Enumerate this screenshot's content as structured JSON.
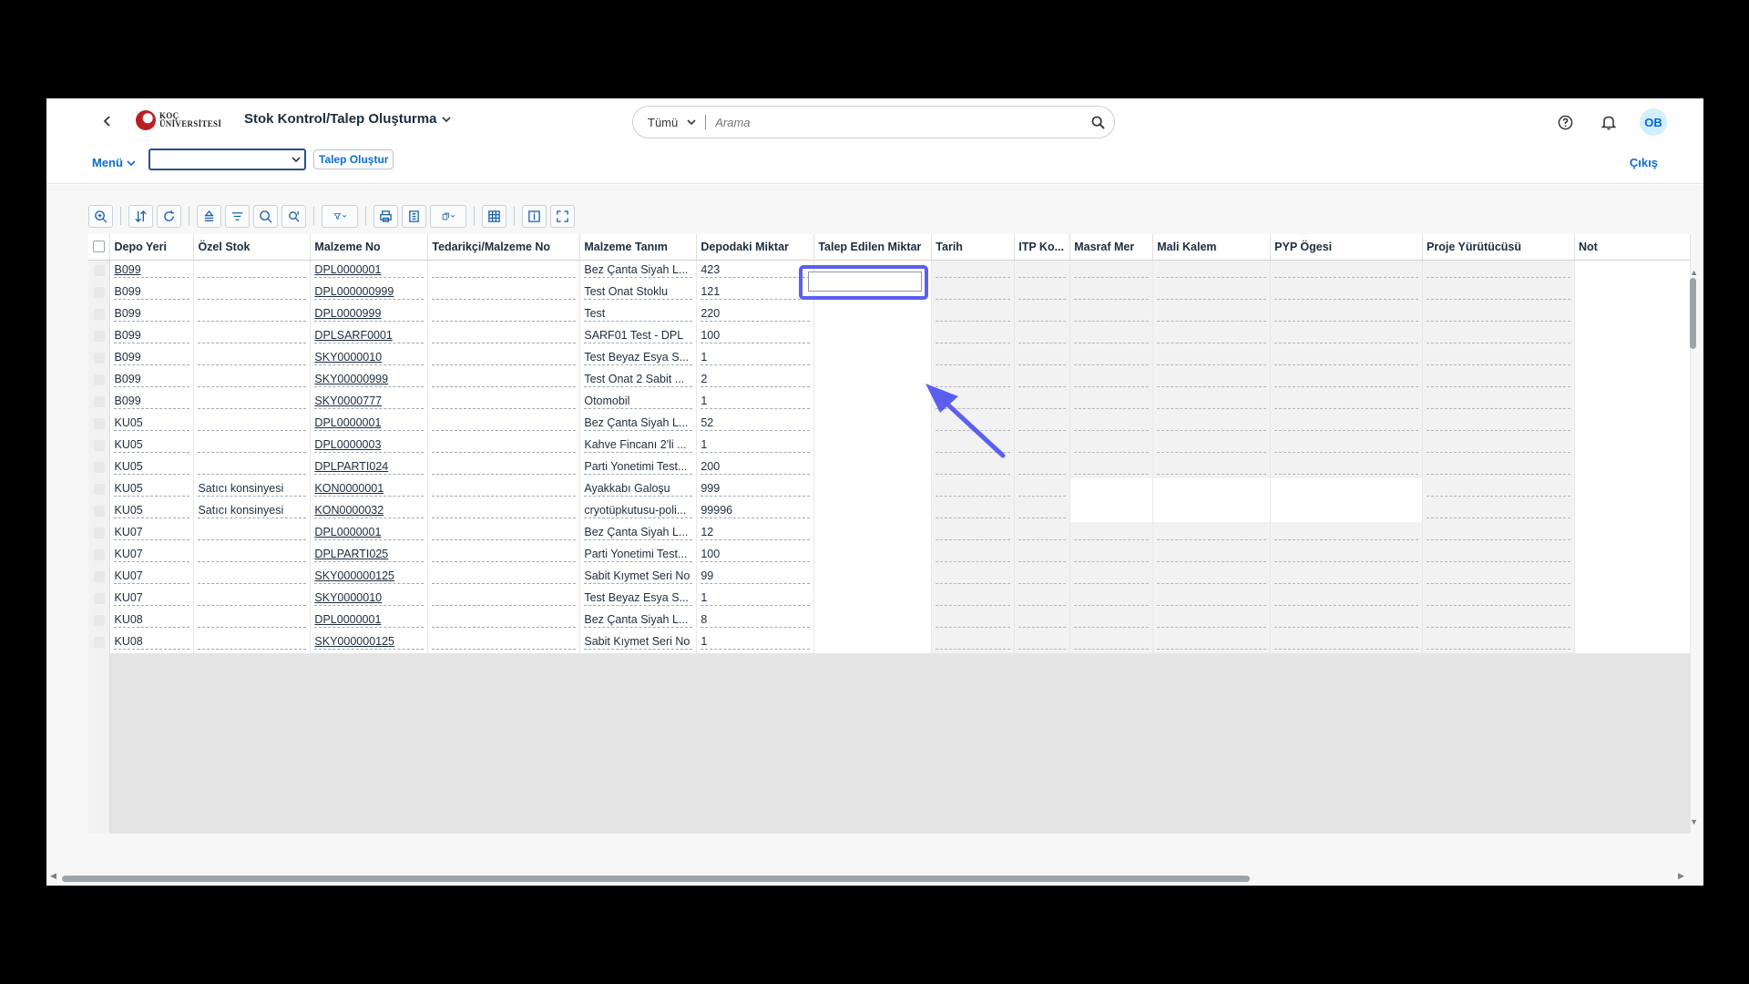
{
  "header": {
    "logo_text_line1": "KOÇ",
    "logo_text_line2": "ÜNİVERSİTESİ",
    "app_title": "Stok Kontrol/Talep Oluşturma",
    "search_scope": "Tümü",
    "search_placeholder": "Arama",
    "avatar_initials": "OB"
  },
  "toolbar": {
    "menu_label": "Menü",
    "combo_value": "",
    "create_request_label": "Talep Oluştur",
    "exit_label": "Çıkış"
  },
  "grid_toolbar_icons": [
    "zoom-in-icon",
    "sort-icon",
    "refresh-icon",
    "sort-asc-icon",
    "filter-list-icon",
    "search-icon",
    "find-next-icon",
    "filter-icon",
    "print-icon",
    "export-icon",
    "copy-icon",
    "grid-layout-icon",
    "details-icon",
    "fullscreen-icon"
  ],
  "table": {
    "columns": [
      "Depo Yeri",
      "Özel Stok",
      "Malzeme No",
      "Tedarikçi/Malzeme No",
      "Malzeme Tanım",
      "Depodaki Miktar",
      "Talep Edilen Miktar",
      "Tarih",
      "ITP Ko...",
      "Masraf Mer",
      "Mali Kalem",
      "PYP Ögesi",
      "Proje Yürütücüsü",
      "Not"
    ],
    "rows": [
      {
        "depo": "B099",
        "ozel": "",
        "malzeme": "DPL0000001",
        "tedarikci": "",
        "tanim": "Bez Çanta Siyah L...",
        "miktar": "423"
      },
      {
        "depo": "B099",
        "ozel": "",
        "malzeme": "DPL000000999",
        "tedarikci": "",
        "tanim": "Test Onat Stoklu",
        "miktar": "121"
      },
      {
        "depo": "B099",
        "ozel": "",
        "malzeme": "DPL0000999",
        "tedarikci": "",
        "tanim": "Test",
        "miktar": "220"
      },
      {
        "depo": "B099",
        "ozel": "",
        "malzeme": "DPLSARF0001",
        "tedarikci": "",
        "tanim": "SARF01 Test - DPL",
        "miktar": "100"
      },
      {
        "depo": "B099",
        "ozel": "",
        "malzeme": "SKY0000010",
        "tedarikci": "",
        "tanim": "Test Beyaz Esya S...",
        "miktar": "1"
      },
      {
        "depo": "B099",
        "ozel": "",
        "malzeme": "SKY00000999",
        "tedarikci": "",
        "tanim": "Test Onat 2 Sabit ...",
        "miktar": "2"
      },
      {
        "depo": "B099",
        "ozel": "",
        "malzeme": "SKY0000777",
        "tedarikci": "",
        "tanim": "Otomobil",
        "miktar": "1"
      },
      {
        "depo": "KU05",
        "ozel": "",
        "malzeme": "DPL0000001",
        "tedarikci": "",
        "tanim": "Bez Çanta Siyah L...",
        "miktar": "52"
      },
      {
        "depo": "KU05",
        "ozel": "",
        "malzeme": "DPL0000003",
        "tedarikci": "",
        "tanim": "Kahve Fincanı 2'li ...",
        "miktar": "1"
      },
      {
        "depo": "KU05",
        "ozel": "",
        "malzeme": "DPLPARTI024",
        "tedarikci": "",
        "tanim": "Parti Yonetimi Test...",
        "miktar": "200"
      },
      {
        "depo": "KU05",
        "ozel": "Satıcı konsinyesi",
        "malzeme": "KON0000001",
        "tedarikci": "",
        "tanim": "Ayakkabı Galoşu",
        "miktar": "999"
      },
      {
        "depo": "KU05",
        "ozel": "Satıcı konsinyesi",
        "malzeme": "KON0000032",
        "tedarikci": "",
        "tanim": "cryotüpkutusu-poli...",
        "miktar": "99996"
      },
      {
        "depo": "KU07",
        "ozel": "",
        "malzeme": "DPL0000001",
        "tedarikci": "",
        "tanim": "Bez Çanta Siyah L...",
        "miktar": "12"
      },
      {
        "depo": "KU07",
        "ozel": "",
        "malzeme": "DPLPARTI025",
        "tedarikci": "",
        "tanim": "Parti Yonetimi Test...",
        "miktar": "100"
      },
      {
        "depo": "KU07",
        "ozel": "",
        "malzeme": "SKY000000125",
        "tedarikci": "",
        "tanim": "Sabit Kıymet Seri No",
        "miktar": "99"
      },
      {
        "depo": "KU07",
        "ozel": "",
        "malzeme": "SKY0000010",
        "tedarikci": "",
        "tanim": "Test Beyaz Esya S...",
        "miktar": "1"
      },
      {
        "depo": "KU08",
        "ozel": "",
        "malzeme": "DPL0000001",
        "tedarikci": "",
        "tanim": "Bez Çanta Siyah L...",
        "miktar": "8"
      },
      {
        "depo": "KU08",
        "ozel": "",
        "malzeme": "SKY000000125",
        "tedarikci": "",
        "tanim": "Sabit Kıymet Seri No",
        "miktar": "1"
      }
    ]
  },
  "colors": {
    "link": "#0a6ed1",
    "highlight": "#5b5ff0",
    "grid_bg": "#e5e5e5"
  }
}
